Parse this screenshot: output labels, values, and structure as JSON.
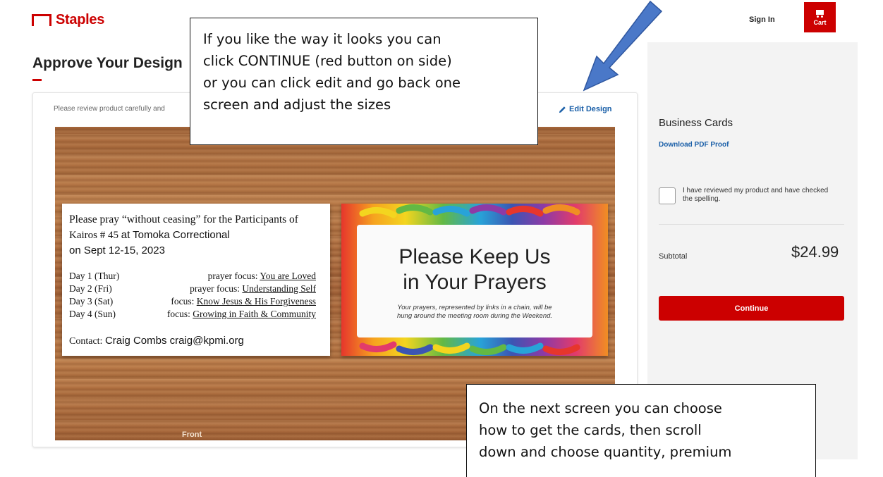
{
  "header": {
    "logo_text": "Staples",
    "sign_in": "Sign In",
    "cart_label": "Cart"
  },
  "main": {
    "page_title": "Approve Your Design",
    "review_note": "Please review product carefully and",
    "edit_design": "Edit Design",
    "front_label": "Front"
  },
  "business_card": {
    "line1": "Please pray “without ceasing” for the Participants of",
    "line2_serif": "Kairos # 45 ",
    "line2_sans": " at Tomoka Correctional",
    "line3": "on Sept 12-15, 2023",
    "days": [
      {
        "day": "Day 1 (Thur)",
        "focus_prefix": "prayer focus: ",
        "focus_topic": "You are Loved"
      },
      {
        "day": "Day 2 (Fri)",
        "focus_prefix": "prayer focus: ",
        "focus_topic": "Understanding Self"
      },
      {
        "day": "Day 3 (Sat)",
        "focus_prefix": "focus: ",
        "focus_topic": "Know Jesus & His Forgiveness"
      },
      {
        "day": "Day 4 (Sun)",
        "focus_prefix": "focus: ",
        "focus_topic": "Growing in Faith & Community"
      }
    ],
    "contact_label": "Contact: ",
    "contact_value": "Craig Combs   craig@kpmi.org",
    "back_title_line1": "Please Keep Us",
    "back_title_line2": "in Your Prayers",
    "back_note_line1": "Your prayers, represented by links in a chain, will be",
    "back_note_line2": "hung around the meeting room during the Weekend."
  },
  "sidebar": {
    "product_name": "Business Cards",
    "download_pdf": "Download PDF Proof",
    "checkbox_label": "I have reviewed my product and have checked the spelling.",
    "subtotal_label": "Subtotal",
    "subtotal_value": "$24.99",
    "continue_label": "Continue"
  },
  "callouts": {
    "top_lines": [
      "If you like the way it looks you can",
      "click CONTINUE (red button on side)",
      "or you can click edit and go back one",
      "screen and adjust the sizes"
    ],
    "bottom_lines": [
      "On the next screen you can choose",
      "how to get the cards, then scroll",
      "down and choose quantity, premium"
    ]
  },
  "colors": {
    "brand_red": "#cc0000",
    "link_blue": "#1a5fa8",
    "arrow_blue": "#4a78c8"
  }
}
